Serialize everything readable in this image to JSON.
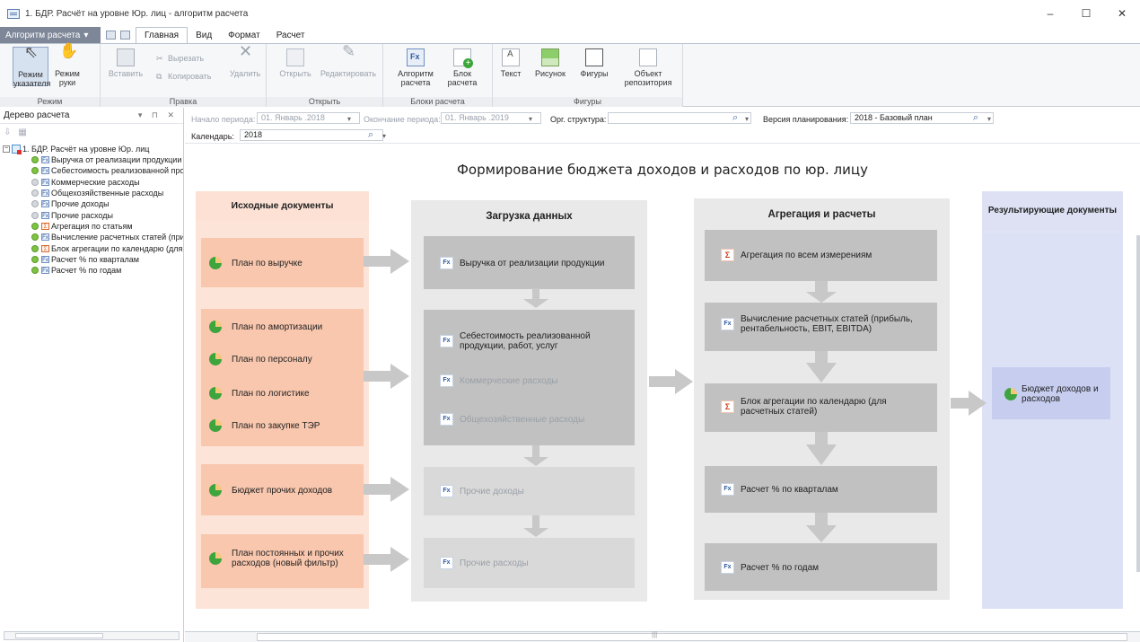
{
  "window": {
    "title": "1. БДР. Расчёт на уровне Юр. лиц - алгоритм расчета",
    "minimize": "–",
    "maximize": "☐",
    "close": "✕"
  },
  "ribbon_tabs": {
    "app_menu": "Алгоритм расчета",
    "tabs": [
      "Главная",
      "Вид",
      "Формат",
      "Расчет"
    ]
  },
  "ribbon": {
    "groups": [
      "Режим",
      "Правка",
      "Открыть",
      "Блоки расчета",
      "Фигуры"
    ],
    "mode_pointer": "Режим указателя",
    "mode_hand": "Режим руки",
    "paste": "Вставить",
    "cut": "Вырезать",
    "copy": "Копировать",
    "delete": "Удалить",
    "open": "Открыть",
    "edit": "Редактировать",
    "algorithm": "Алгоритм расчета",
    "block": "Блок расчета",
    "text": "Текст",
    "picture": "Рисунок",
    "shapes": "Фигуры",
    "repo_object": "Объект репозитория"
  },
  "tree_panel": {
    "title": "Дерево расчета",
    "pin_icons": "▾ ⊓ ✕",
    "root": "1. БДР. Расчёт на уровне Юр. лиц",
    "items": [
      {
        "label": "Выручка от реализации продукции",
        "status": "green",
        "kind": "Fx"
      },
      {
        "label": "Себестоимость реализованной проду",
        "status": "green",
        "kind": "Fx"
      },
      {
        "label": "Коммерческие расходы",
        "status": "gray",
        "kind": "Fx"
      },
      {
        "label": "Общехозяйственные расходы",
        "status": "gray",
        "kind": "Fx"
      },
      {
        "label": "Прочие доходы",
        "status": "gray",
        "kind": "Fx"
      },
      {
        "label": "Прочие расходы",
        "status": "gray",
        "kind": "Fx"
      },
      {
        "label": "Агрегация по статьям",
        "status": "green",
        "kind": "Σ"
      },
      {
        "label": "Вычисление расчетных статей (приб",
        "status": "green",
        "kind": "Fx"
      },
      {
        "label": "Блок агрегации по календарю (для р",
        "status": "green",
        "kind": "Σ"
      },
      {
        "label": "Расчет % по кварталам",
        "status": "green",
        "kind": "Fx"
      },
      {
        "label": "Расчет % по годам",
        "status": "green",
        "kind": "Fx"
      }
    ]
  },
  "filters": {
    "period_start_label": "Начало периода:",
    "period_start_value": "01. Январь .2018",
    "period_end_label": "Окончание периода:",
    "period_end_value": "01. Январь .2019",
    "org_label": "Орг. структура:",
    "org_value": "",
    "version_label": "Версия планирования:",
    "version_value": "2018 - Базовый план",
    "calendar_label": "Календарь:",
    "calendar_value": "2018"
  },
  "diagram": {
    "title": "Формирование бюджета доходов и расходов по юр. лицу",
    "columns": {
      "source": "Исходные документы",
      "load": "Загрузка данных",
      "aggregation": "Агрегация и расчеты",
      "result": "Результирующие документы"
    },
    "source_docs": [
      "План по выручке",
      "План по амортизации",
      "План по персоналу",
      "План по логистике",
      "План по закупке ТЭР",
      "Бюджет прочих доходов",
      "План постоянных и прочих расходов (новый фильтр)"
    ],
    "load_blocks": [
      "Выручка от реализации продукции",
      "Себестоимость реализованной продукции, работ, услуг",
      "Коммерческие расходы",
      "Общехозяйственные расходы",
      "Прочие доходы",
      "Прочие расходы"
    ],
    "agg_blocks": [
      "Агрегация по всем измерениям",
      "Вычисление расчетных статей (прибыль, рентабельность, EBIT, EBITDA)",
      "Блок агрегации по календарю (для расчетных статей)",
      "Расчет % по кварталам",
      "Расчет % по годам"
    ],
    "result_docs": [
      "Бюджет доходов и расходов"
    ],
    "fx_label": "Fx",
    "sigma_label": "Σ"
  },
  "colors": {
    "source_bg": "#fde4d8",
    "source_box": "#f9c7ae",
    "load_bg": "#e9e9e9",
    "load_box": "#c1c1c1",
    "result_bg": "#dfe3f5",
    "result_box": "#c6cdef",
    "arrow": "#c8c8c8"
  }
}
